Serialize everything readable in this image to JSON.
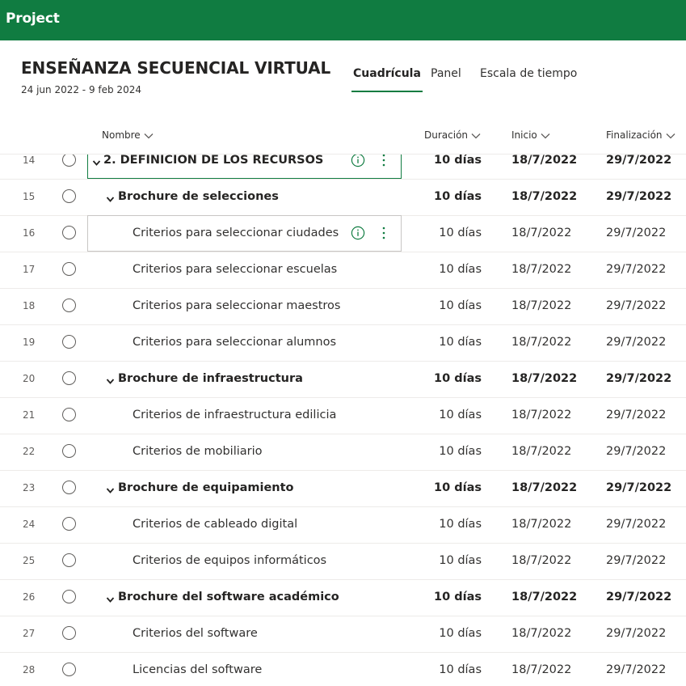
{
  "app": {
    "title": "Project"
  },
  "project": {
    "title": "ENSEÑANZA SECUENCIAL VIRTUAL",
    "dates": "24 jun 2022 - 9 feb 2024"
  },
  "views": {
    "tabs": [
      {
        "label": "Cuadrícula",
        "active": true
      },
      {
        "label": "Panel",
        "active": false
      },
      {
        "label": "Escala de tiempo",
        "active": false
      }
    ]
  },
  "columns": {
    "name": "Nombre",
    "duration": "Duración",
    "start": "Inicio",
    "finish": "Finalización"
  },
  "colors": {
    "brand": "#107c41",
    "text": "#323130",
    "divider": "#edebe9"
  },
  "rows": [
    {
      "num": "14",
      "name": "2. DEFINICIÓN DE LOS RECURSOS",
      "duration": "10 días",
      "start": "18/7/2022",
      "finish": "29/7/2022",
      "level": 0,
      "summary": true,
      "state": "focused"
    },
    {
      "num": "15",
      "name": "Brochure de selecciones",
      "duration": "10 días",
      "start": "18/7/2022",
      "finish": "29/7/2022",
      "level": 1,
      "summary": true,
      "state": ""
    },
    {
      "num": "16",
      "name": "Criterios para seleccionar ciudades",
      "duration": "10 días",
      "start": "18/7/2022",
      "finish": "29/7/2022",
      "level": 2,
      "summary": false,
      "state": "hovered"
    },
    {
      "num": "17",
      "name": "Criterios para seleccionar escuelas",
      "duration": "10 días",
      "start": "18/7/2022",
      "finish": "29/7/2022",
      "level": 2,
      "summary": false,
      "state": ""
    },
    {
      "num": "18",
      "name": "Criterios para seleccionar maestros",
      "duration": "10 días",
      "start": "18/7/2022",
      "finish": "29/7/2022",
      "level": 2,
      "summary": false,
      "state": ""
    },
    {
      "num": "19",
      "name": "Criterios para seleccionar alumnos",
      "duration": "10 días",
      "start": "18/7/2022",
      "finish": "29/7/2022",
      "level": 2,
      "summary": false,
      "state": ""
    },
    {
      "num": "20",
      "name": "Brochure de infraestructura",
      "duration": "10 días",
      "start": "18/7/2022",
      "finish": "29/7/2022",
      "level": 1,
      "summary": true,
      "state": ""
    },
    {
      "num": "21",
      "name": "Criterios de infraestructura edilicia",
      "duration": "10 días",
      "start": "18/7/2022",
      "finish": "29/7/2022",
      "level": 2,
      "summary": false,
      "state": ""
    },
    {
      "num": "22",
      "name": "Criterios de mobiliario",
      "duration": "10 días",
      "start": "18/7/2022",
      "finish": "29/7/2022",
      "level": 2,
      "summary": false,
      "state": ""
    },
    {
      "num": "23",
      "name": "Brochure de equipamiento",
      "duration": "10 días",
      "start": "18/7/2022",
      "finish": "29/7/2022",
      "level": 1,
      "summary": true,
      "state": ""
    },
    {
      "num": "24",
      "name": "Criterios de cableado digital",
      "duration": "10 días",
      "start": "18/7/2022",
      "finish": "29/7/2022",
      "level": 2,
      "summary": false,
      "state": ""
    },
    {
      "num": "25",
      "name": "Criterios de equipos informáticos",
      "duration": "10 días",
      "start": "18/7/2022",
      "finish": "29/7/2022",
      "level": 2,
      "summary": false,
      "state": ""
    },
    {
      "num": "26",
      "name": "Brochure del software académico",
      "duration": "10 días",
      "start": "18/7/2022",
      "finish": "29/7/2022",
      "level": 1,
      "summary": true,
      "state": ""
    },
    {
      "num": "27",
      "name": "Criterios del software",
      "duration": "10 días",
      "start": "18/7/2022",
      "finish": "29/7/2022",
      "level": 2,
      "summary": false,
      "state": ""
    },
    {
      "num": "28",
      "name": "Licencias del software",
      "duration": "10 días",
      "start": "18/7/2022",
      "finish": "29/7/2022",
      "level": 2,
      "summary": false,
      "state": ""
    }
  ]
}
